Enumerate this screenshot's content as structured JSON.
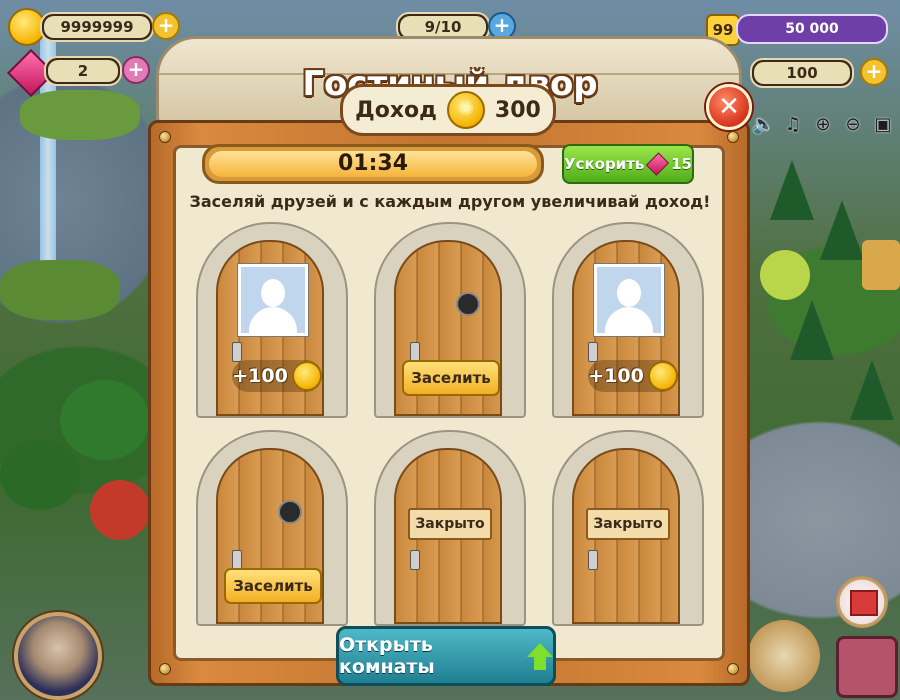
{
  "hud": {
    "coins": "9999999",
    "gems": "2",
    "population": "9/10",
    "level": "99",
    "xp": "50 000",
    "energy": "100",
    "tools": [
      "speaker-icon",
      "music-icon",
      "zoom-in-icon",
      "zoom-out-icon",
      "camera-icon"
    ]
  },
  "dialog": {
    "title": "Гостиный двор",
    "income_label": "Доход",
    "income_value": "300",
    "timer": "01:34",
    "timer_progress": 1.0,
    "speedup_label": "Ускорить",
    "speedup_cost": "15",
    "hint": "Заселяй друзей и с каждым другом увеличивай доход!",
    "open_rooms_label": "Открыть комнаты",
    "doors": [
      {
        "state": "occupied",
        "reward": "+100"
      },
      {
        "state": "empty",
        "button": "Заселить"
      },
      {
        "state": "occupied",
        "reward": "+100"
      },
      {
        "state": "empty",
        "button": "Заселить"
      },
      {
        "state": "closed",
        "sign": "Закрыто"
      },
      {
        "state": "closed",
        "sign": "Закрыто"
      }
    ]
  },
  "colors": {
    "frame": "#c27430",
    "panel": "#f0e9cf",
    "speedup": "#4fae1a",
    "open_button": "#1f7f92",
    "close_button": "#d8331a"
  }
}
